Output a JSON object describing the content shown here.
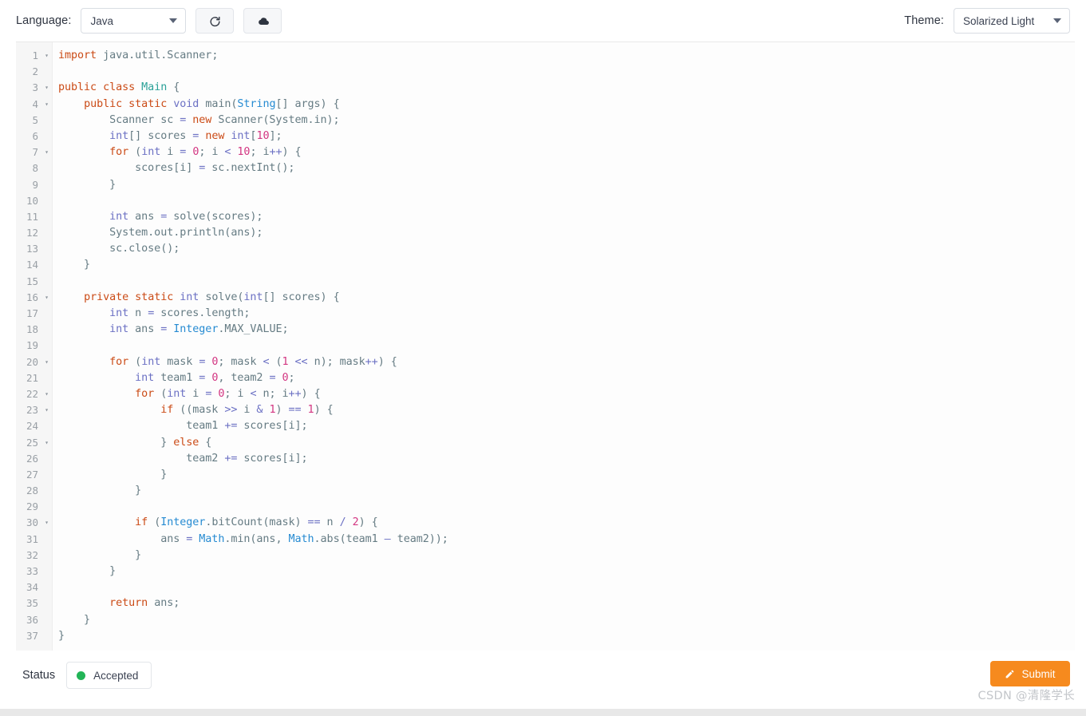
{
  "toolbar": {
    "language_label": "Language:",
    "language_value": "Java",
    "theme_label": "Theme:",
    "theme_value": "Solarized Light",
    "reset_icon": "refresh-icon",
    "upload_icon": "cloud-upload-icon",
    "caret_icon": "chevron-down-icon"
  },
  "editor": {
    "total_lines": 37,
    "fold_lines": [
      1,
      3,
      4,
      7,
      16,
      20,
      22,
      23,
      25,
      30
    ],
    "fold_glyph": "▾",
    "lines": [
      {
        "n": 1,
        "tokens": [
          [
            "k",
            "import"
          ],
          [
            "pl",
            " java"
          ],
          [
            "pl",
            "."
          ],
          [
            "pl",
            "util"
          ],
          [
            "pl",
            "."
          ],
          [
            "pl",
            "Scanner;"
          ]
        ]
      },
      {
        "n": 2,
        "tokens": []
      },
      {
        "n": 3,
        "tokens": [
          [
            "k",
            "public"
          ],
          [
            "pl",
            " "
          ],
          [
            "k",
            "class"
          ],
          [
            "pl",
            " "
          ],
          [
            "cn",
            "Main"
          ],
          [
            "pl",
            " {"
          ]
        ]
      },
      {
        "n": 4,
        "tokens": [
          [
            "pl",
            "    "
          ],
          [
            "k",
            "public"
          ],
          [
            "pl",
            " "
          ],
          [
            "k",
            "static"
          ],
          [
            "pl",
            " "
          ],
          [
            "pt",
            "void"
          ],
          [
            "pl",
            " main("
          ],
          [
            "ty",
            "String"
          ],
          [
            "pl",
            "[] args) {"
          ]
        ]
      },
      {
        "n": 5,
        "tokens": [
          [
            "pl",
            "        Scanner sc "
          ],
          [
            "op",
            "="
          ],
          [
            "pl",
            " "
          ],
          [
            "k",
            "new"
          ],
          [
            "pl",
            " Scanner(System.in);"
          ]
        ]
      },
      {
        "n": 6,
        "tokens": [
          [
            "pl",
            "        "
          ],
          [
            "pt",
            "int"
          ],
          [
            "pl",
            "[] scores "
          ],
          [
            "op",
            "="
          ],
          [
            "pl",
            " "
          ],
          [
            "k",
            "new"
          ],
          [
            "pl",
            " "
          ],
          [
            "pt",
            "int"
          ],
          [
            "pl",
            "["
          ],
          [
            "nu",
            "10"
          ],
          [
            "pl",
            "];"
          ]
        ]
      },
      {
        "n": 7,
        "tokens": [
          [
            "pl",
            "        "
          ],
          [
            "k",
            "for"
          ],
          [
            "pl",
            " ("
          ],
          [
            "pt",
            "int"
          ],
          [
            "pl",
            " i "
          ],
          [
            "op",
            "="
          ],
          [
            "pl",
            " "
          ],
          [
            "nu",
            "0"
          ],
          [
            "pl",
            "; i "
          ],
          [
            "op",
            "<"
          ],
          [
            "pl",
            " "
          ],
          [
            "nu",
            "10"
          ],
          [
            "pl",
            "; i"
          ],
          [
            "op",
            "++"
          ],
          [
            "pl",
            ") {"
          ]
        ]
      },
      {
        "n": 8,
        "tokens": [
          [
            "pl",
            "            scores[i] "
          ],
          [
            "op",
            "="
          ],
          [
            "pl",
            " sc.nextInt();"
          ]
        ]
      },
      {
        "n": 9,
        "tokens": [
          [
            "pl",
            "        }"
          ]
        ]
      },
      {
        "n": 10,
        "tokens": []
      },
      {
        "n": 11,
        "tokens": [
          [
            "pl",
            "        "
          ],
          [
            "pt",
            "int"
          ],
          [
            "pl",
            " ans "
          ],
          [
            "op",
            "="
          ],
          [
            "pl",
            " solve(scores);"
          ]
        ]
      },
      {
        "n": 12,
        "tokens": [
          [
            "pl",
            "        System.out.println(ans);"
          ]
        ]
      },
      {
        "n": 13,
        "tokens": [
          [
            "pl",
            "        sc.close();"
          ]
        ]
      },
      {
        "n": 14,
        "tokens": [
          [
            "pl",
            "    }"
          ]
        ]
      },
      {
        "n": 15,
        "tokens": []
      },
      {
        "n": 16,
        "tokens": [
          [
            "pl",
            "    "
          ],
          [
            "k",
            "private"
          ],
          [
            "pl",
            " "
          ],
          [
            "k",
            "static"
          ],
          [
            "pl",
            " "
          ],
          [
            "pt",
            "int"
          ],
          [
            "pl",
            " solve("
          ],
          [
            "pt",
            "int"
          ],
          [
            "pl",
            "[] scores) {"
          ]
        ]
      },
      {
        "n": 17,
        "tokens": [
          [
            "pl",
            "        "
          ],
          [
            "pt",
            "int"
          ],
          [
            "pl",
            " n "
          ],
          [
            "op",
            "="
          ],
          [
            "pl",
            " scores.length;"
          ]
        ]
      },
      {
        "n": 18,
        "tokens": [
          [
            "pl",
            "        "
          ],
          [
            "pt",
            "int"
          ],
          [
            "pl",
            " ans "
          ],
          [
            "op",
            "="
          ],
          [
            "pl",
            " "
          ],
          [
            "ty",
            "Integer"
          ],
          [
            "pl",
            ".MAX_VALUE;"
          ]
        ]
      },
      {
        "n": 19,
        "tokens": []
      },
      {
        "n": 20,
        "tokens": [
          [
            "pl",
            "        "
          ],
          [
            "k",
            "for"
          ],
          [
            "pl",
            " ("
          ],
          [
            "pt",
            "int"
          ],
          [
            "pl",
            " mask "
          ],
          [
            "op",
            "="
          ],
          [
            "pl",
            " "
          ],
          [
            "nu",
            "0"
          ],
          [
            "pl",
            "; mask "
          ],
          [
            "op",
            "<"
          ],
          [
            "pl",
            " ("
          ],
          [
            "nu",
            "1"
          ],
          [
            "pl",
            " "
          ],
          [
            "op",
            "<<"
          ],
          [
            "pl",
            " n); mask"
          ],
          [
            "op",
            "++"
          ],
          [
            "pl",
            ") {"
          ]
        ]
      },
      {
        "n": 21,
        "tokens": [
          [
            "pl",
            "            "
          ],
          [
            "pt",
            "int"
          ],
          [
            "pl",
            " team1 "
          ],
          [
            "op",
            "="
          ],
          [
            "pl",
            " "
          ],
          [
            "nu",
            "0"
          ],
          [
            "pl",
            ", team2 "
          ],
          [
            "op",
            "="
          ],
          [
            "pl",
            " "
          ],
          [
            "nu",
            "0"
          ],
          [
            "pl",
            ";"
          ]
        ]
      },
      {
        "n": 22,
        "tokens": [
          [
            "pl",
            "            "
          ],
          [
            "k",
            "for"
          ],
          [
            "pl",
            " ("
          ],
          [
            "pt",
            "int"
          ],
          [
            "pl",
            " i "
          ],
          [
            "op",
            "="
          ],
          [
            "pl",
            " "
          ],
          [
            "nu",
            "0"
          ],
          [
            "pl",
            "; i "
          ],
          [
            "op",
            "<"
          ],
          [
            "pl",
            " n; i"
          ],
          [
            "op",
            "++"
          ],
          [
            "pl",
            ") {"
          ]
        ]
      },
      {
        "n": 23,
        "tokens": [
          [
            "pl",
            "                "
          ],
          [
            "k",
            "if"
          ],
          [
            "pl",
            " ((mask "
          ],
          [
            "op",
            ">>"
          ],
          [
            "pl",
            " i "
          ],
          [
            "op",
            "&"
          ],
          [
            "pl",
            " "
          ],
          [
            "nu",
            "1"
          ],
          [
            "pl",
            ") "
          ],
          [
            "op",
            "=="
          ],
          [
            "pl",
            " "
          ],
          [
            "nu",
            "1"
          ],
          [
            "pl",
            ") {"
          ]
        ]
      },
      {
        "n": 24,
        "tokens": [
          [
            "pl",
            "                    team1 "
          ],
          [
            "op",
            "+="
          ],
          [
            "pl",
            " scores[i];"
          ]
        ]
      },
      {
        "n": 25,
        "tokens": [
          [
            "pl",
            "                } "
          ],
          [
            "k",
            "else"
          ],
          [
            "pl",
            " {"
          ]
        ]
      },
      {
        "n": 26,
        "tokens": [
          [
            "pl",
            "                    team2 "
          ],
          [
            "op",
            "+="
          ],
          [
            "pl",
            " scores[i];"
          ]
        ]
      },
      {
        "n": 27,
        "tokens": [
          [
            "pl",
            "                }"
          ]
        ]
      },
      {
        "n": 28,
        "tokens": [
          [
            "pl",
            "            }"
          ]
        ]
      },
      {
        "n": 29,
        "tokens": []
      },
      {
        "n": 30,
        "tokens": [
          [
            "pl",
            "            "
          ],
          [
            "k",
            "if"
          ],
          [
            "pl",
            " ("
          ],
          [
            "ty",
            "Integer"
          ],
          [
            "pl",
            ".bitCount(mask) "
          ],
          [
            "op",
            "=="
          ],
          [
            "pl",
            " n "
          ],
          [
            "op",
            "/"
          ],
          [
            "pl",
            " "
          ],
          [
            "nu",
            "2"
          ],
          [
            "pl",
            ") {"
          ]
        ]
      },
      {
        "n": 31,
        "tokens": [
          [
            "pl",
            "                ans "
          ],
          [
            "op",
            "="
          ],
          [
            "pl",
            " "
          ],
          [
            "ty",
            "Math"
          ],
          [
            "pl",
            ".min(ans, "
          ],
          [
            "ty",
            "Math"
          ],
          [
            "pl",
            ".abs(team1 "
          ],
          [
            "op",
            "–"
          ],
          [
            "pl",
            " team2));"
          ]
        ]
      },
      {
        "n": 32,
        "tokens": [
          [
            "pl",
            "            }"
          ]
        ]
      },
      {
        "n": 33,
        "tokens": [
          [
            "pl",
            "        }"
          ]
        ]
      },
      {
        "n": 34,
        "tokens": []
      },
      {
        "n": 35,
        "tokens": [
          [
            "pl",
            "        "
          ],
          [
            "k",
            "return"
          ],
          [
            "pl",
            " ans;"
          ]
        ]
      },
      {
        "n": 36,
        "tokens": [
          [
            "pl",
            "    }"
          ]
        ]
      },
      {
        "n": 37,
        "tokens": [
          [
            "pl",
            "}"
          ]
        ]
      }
    ]
  },
  "statusbar": {
    "label": "Status",
    "value": "Accepted",
    "dot_color": "#22b457",
    "submit_label": "Submit",
    "submit_icon": "pencil-icon",
    "submit_color": "#f68a1e"
  },
  "footer": {
    "watermark": "CSDN @清隆学长"
  }
}
